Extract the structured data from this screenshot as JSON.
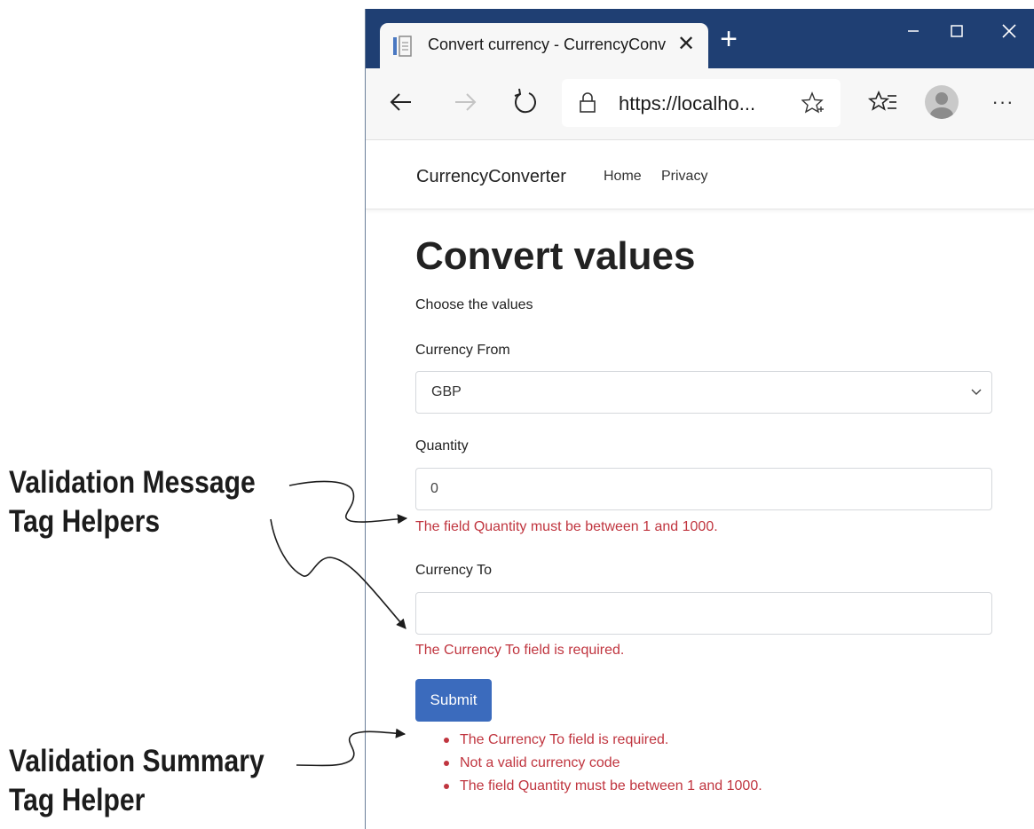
{
  "browser": {
    "tab_title": "Convert currency - CurrencyConv",
    "tab_close_glyph": "✕",
    "new_tab_glyph": "+",
    "url": "https://localho...",
    "menu_glyph": "···",
    "titlebar_color": "#1f3f73",
    "icons": [
      "page-icon",
      "close-icon",
      "plus-icon",
      "minimize-icon",
      "maximize-icon",
      "close-window-icon",
      "back-arrow-icon",
      "forward-arrow-icon",
      "refresh-icon",
      "lock-icon",
      "star-icon",
      "favorites-icon",
      "avatar-icon",
      "more-icon"
    ]
  },
  "navbar": {
    "brand": "CurrencyConverter",
    "links": [
      "Home",
      "Privacy"
    ]
  },
  "page": {
    "title": "Convert values",
    "subtitle": "Choose the values",
    "currency_from": {
      "label": "Currency From",
      "value": "GBP"
    },
    "quantity": {
      "label": "Quantity",
      "value": "0",
      "error": "The field Quantity must be between 1 and 1000."
    },
    "currency_to": {
      "label": "Currency To",
      "value": "",
      "error": "The Currency To field is required."
    },
    "submit_label": "Submit",
    "validation_summary": [
      "The Currency To field is required.",
      "Not a valid currency code",
      "The field Quantity must be between 1 and 1000."
    ],
    "error_color": "#c0353f",
    "button_color": "#3b6bbd"
  },
  "annotations": {
    "message_helpers": [
      "Validation Message",
      "Tag Helpers"
    ],
    "summary_helper": [
      "Validation Summary",
      "Tag Helper"
    ]
  }
}
